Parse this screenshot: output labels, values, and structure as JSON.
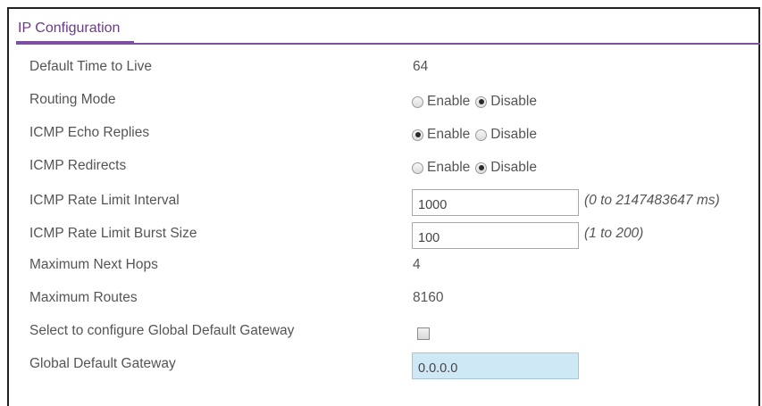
{
  "section": {
    "title": "IP Configuration"
  },
  "rows": {
    "ttl": {
      "label": "Default Time to Live",
      "value": "64"
    },
    "routing_mode": {
      "label": "Routing Mode",
      "enable": "Enable",
      "disable": "Disable",
      "selected": "Disable"
    },
    "icmp_echo": {
      "label": "ICMP Echo Replies",
      "enable": "Enable",
      "disable": "Disable",
      "selected": "Enable"
    },
    "icmp_redirects": {
      "label": "ICMP Redirects",
      "enable": "Enable",
      "disable": "Disable",
      "selected": "Disable"
    },
    "rate_interval": {
      "label": "ICMP Rate Limit Interval",
      "value": "1000",
      "hint": "(0 to 2147483647 ms)"
    },
    "burst_size": {
      "label": "ICMP Rate Limit Burst Size",
      "value": "100",
      "hint": "(1 to 200)"
    },
    "max_next_hops": {
      "label": "Maximum Next Hops",
      "value": "4"
    },
    "max_routes": {
      "label": "Maximum Routes",
      "value": "8160"
    },
    "global_gateway_select": {
      "label": "Select to configure Global Default Gateway",
      "checked": false
    },
    "global_gateway": {
      "label": "Global Default Gateway",
      "value": "0.0.0.0"
    }
  }
}
